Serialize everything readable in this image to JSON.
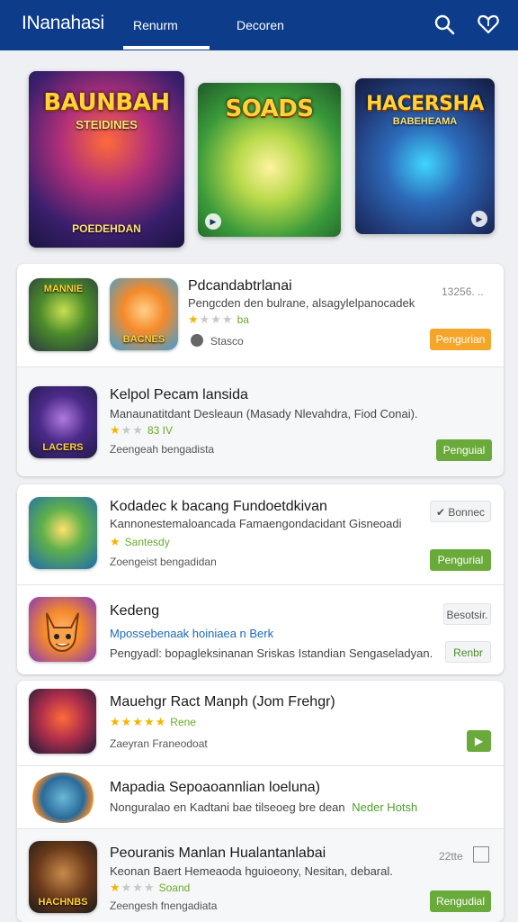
{
  "header": {
    "app_title": "INanahasi",
    "tabs": [
      {
        "label": "Renurm",
        "active": true
      },
      {
        "label": "Decoren",
        "active": false
      }
    ],
    "icons": [
      "search-icon",
      "heart-icon"
    ],
    "background_color": "#0d3d8a"
  },
  "banners": [
    {
      "title": "BAUNBAH",
      "subtitle": "STEIDINES",
      "caption": "POEDEHDAN"
    },
    {
      "title": "SOADS",
      "subtitle": "",
      "caption": ""
    },
    {
      "title": "HACERSHA",
      "subtitle": "BABEHEAMA",
      "caption": ""
    }
  ],
  "cards": [
    {
      "rows": [
        {
          "title": "Pdcandabtrlanai",
          "description": "Pengcden den bulrane, alsagylelpanocadek",
          "rating_text": "ba",
          "rating_stars": 1,
          "meta": "Stasco",
          "side_text": "13256. ..",
          "button_label": "Pengurian",
          "icon_labels": [
            "MANNIE",
            "BACNES"
          ]
        },
        {
          "title": "Kelpol Pecam lansida",
          "description": "Manaunatitdant Desleaun (Masady Nlevahdra, Fiod Conai).",
          "rating_text": "83 IV",
          "rating_stars": 1,
          "meta": "Zeengeah bengadista",
          "button_label": "Penguial",
          "icon_label": "LACERS"
        }
      ]
    },
    {
      "rows": [
        {
          "title": "Kodadec k bacang Fundoetdkivan",
          "description": "Kannonestemaloancada Famaengondacidant Gisneoadi",
          "rating_text": "Santesdy",
          "rating_stars": 1,
          "meta": "Zoengeist bengadidan",
          "side_text": "Bonnec",
          "button_label": "Pengurial"
        },
        {
          "title": "Kedeng",
          "description": "Mpossebenaak hoiniaea n Berk",
          "meta": "Pengyadl: bopagleksinanan Sriskas Istandian Sengaseladyan.",
          "side_text": "Besotsir.",
          "button_label": "Renbr"
        }
      ]
    },
    {
      "rows": [
        {
          "title": "Mauehgr Ract Manph (Jom Frehgr)",
          "rating_text": "Rene",
          "rating_stars": 5,
          "meta": "Zaeyran Franeodoat",
          "button_label": "▶"
        },
        {
          "title": "Mapadia Sepoaoannlian loeluna)",
          "description": "Nonguralao en Kadtani bae tilseoeg bre dean",
          "link_text": "Neder Hotsh"
        },
        {
          "title": "Peouranis Manlan Hualantanlabai",
          "description": "Keonan Baert Hemeaoda hguioeony, Nesitan, debaral.",
          "rating_text": "Soand",
          "rating_stars": 1,
          "meta": "Zeengesh fnengadiata",
          "side_text": "22tte",
          "button_label": "Rengudial",
          "icon_label": "HACHNBS"
        }
      ]
    }
  ]
}
